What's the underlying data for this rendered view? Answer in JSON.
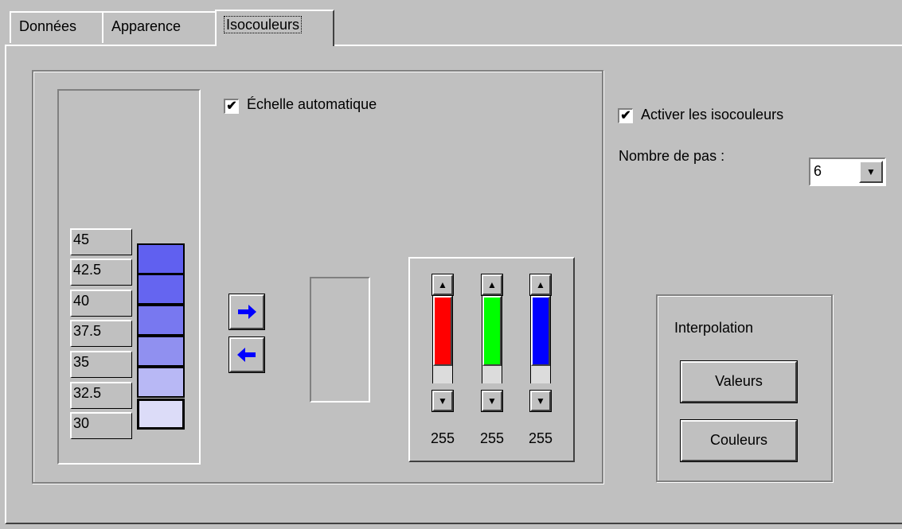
{
  "tabs": [
    {
      "label": "Données",
      "active": false
    },
    {
      "label": "Apparence",
      "active": false
    },
    {
      "label": "Isocouleurs",
      "active": true
    }
  ],
  "scale": {
    "values": [
      "45",
      "42.5",
      "40",
      "37.5",
      "35",
      "32.5",
      "30"
    ],
    "swatch_colors": [
      "#6060f0",
      "#6565f0",
      "#7878f0",
      "#9090f0",
      "#b8b8f5",
      "#dcdcf8"
    ]
  },
  "auto_scale": {
    "label": "Échelle automatique",
    "checked": true
  },
  "transfer": {
    "right_icon": "arrow-right-icon",
    "left_icon": "arrow-left-icon"
  },
  "rgb": {
    "channels": [
      {
        "name": "red",
        "color": "#ff0000",
        "value": "255"
      },
      {
        "name": "green",
        "color": "#00ff00",
        "value": "255"
      },
      {
        "name": "blue",
        "color": "#0000ff",
        "value": "255"
      }
    ]
  },
  "isocolors": {
    "enable_label": "Activer les isocouleurs",
    "enabled": true,
    "steps_label": "Nombre de pas :",
    "steps_value": "6"
  },
  "interpolation": {
    "title": "Interpolation",
    "values_button": "Valeurs",
    "colors_button": "Couleurs"
  }
}
